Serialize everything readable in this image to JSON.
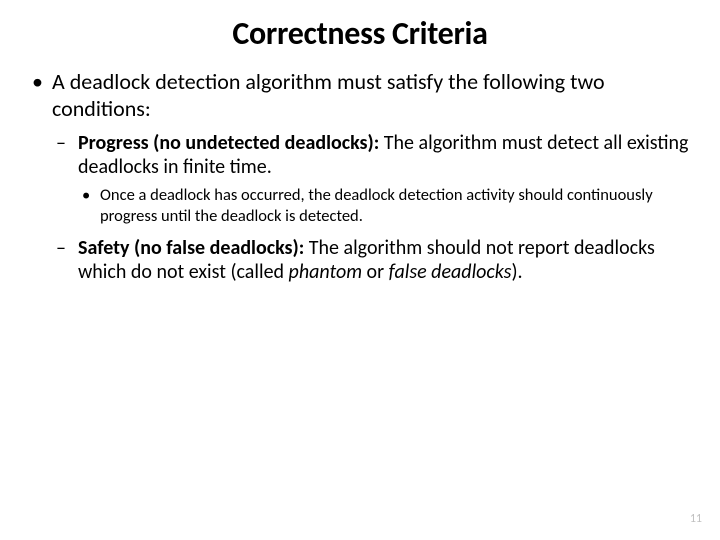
{
  "title": "Correctness Criteria",
  "intro": "A deadlock detection algorithm must satisfy the following two conditions:",
  "progress": {
    "label": "Progress (no undetected deadlocks):",
    "text": "  The algorithm must detect all existing deadlocks in finite time.",
    "sub": "Once a deadlock has occurred, the deadlock detection activity should continuously progress until the deadlock is detected."
  },
  "safety": {
    "label": "Safety (no false deadlocks):",
    "text_a": "  The algorithm should not report deadlocks which do not exist (called ",
    "phantom": "phantom",
    "or": " or ",
    "false_deadlocks": "false deadlocks",
    "text_b": ")."
  },
  "page_number": "11"
}
